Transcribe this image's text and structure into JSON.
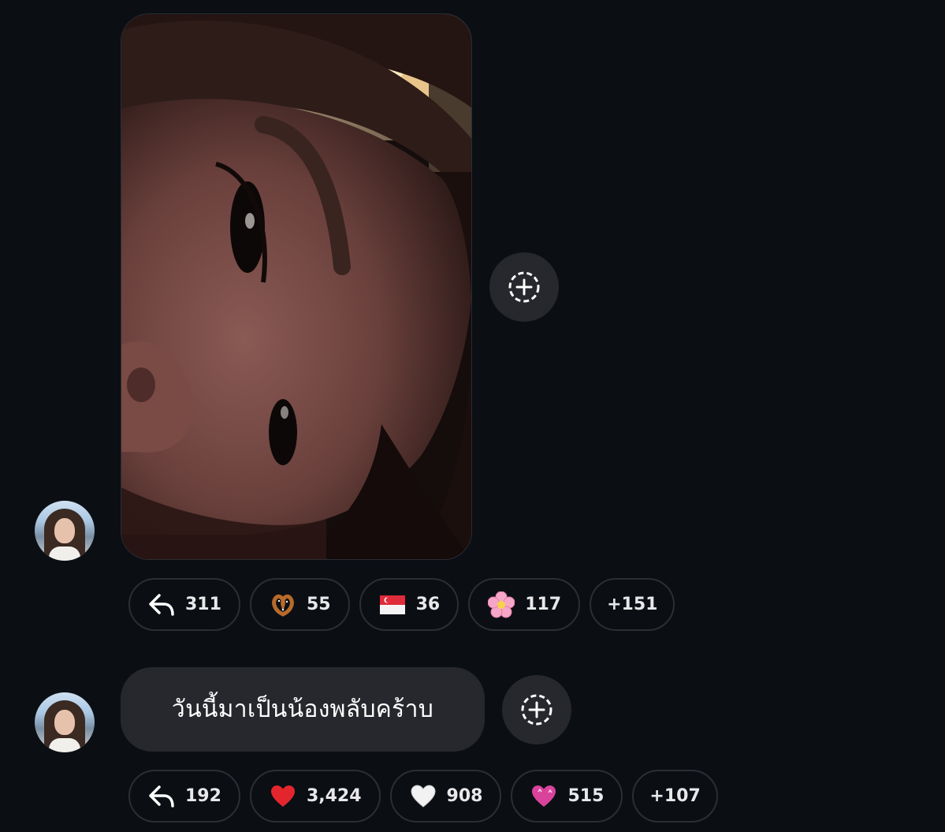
{
  "messages": [
    {
      "type": "photo",
      "avatar_icon": "user-avatar",
      "reactions": [
        {
          "icon": "reply-arrow-icon",
          "count": "311"
        },
        {
          "icon": "pretzel-emoji-icon",
          "count": "55"
        },
        {
          "icon": "singapore-flag-emoji-icon",
          "count": "36"
        },
        {
          "icon": "cherry-blossom-emoji-icon",
          "count": "117"
        }
      ],
      "more": "+151"
    },
    {
      "type": "text",
      "avatar_icon": "user-avatar",
      "text": "วันนี้มาเป็นน้องพลับคร้าบ",
      "reactions": [
        {
          "icon": "reply-arrow-icon",
          "count": "192"
        },
        {
          "icon": "red-heart-emoji-icon",
          "count": "3,424"
        },
        {
          "icon": "white-heart-emoji-icon",
          "count": "908"
        },
        {
          "icon": "pink-heart-emoji-icon",
          "count": "515"
        }
      ],
      "more": "+107"
    }
  ],
  "colors": {
    "background": "#0b0f14",
    "bubble": "#26282d",
    "pill_border": "#2b2e33",
    "text": "#e8e8ea"
  }
}
